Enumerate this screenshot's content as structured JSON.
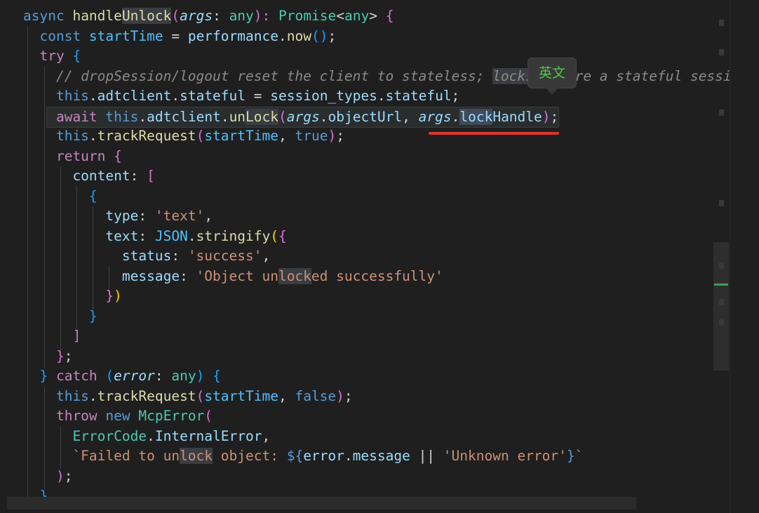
{
  "editor": {
    "lines": [
      [
        {
          "t": "async ",
          "c": "#569cd6"
        },
        {
          "t": "handle",
          "c": "#dcdcaa"
        },
        {
          "t": "Unlock",
          "c": "#dcdcaa",
          "h": 1
        },
        {
          "t": "(",
          "c": "#da70d6"
        },
        {
          "t": "args",
          "c": "#9cdcfe",
          "i": 1
        },
        {
          "t": ": ",
          "c": "#d4d4d4"
        },
        {
          "t": "any",
          "c": "#4ec9b0"
        },
        {
          "t": "): ",
          "c": "#da70d6"
        },
        {
          "t": "Promise",
          "c": "#4ec9b0"
        },
        {
          "t": "<",
          "c": "#d4d4d4"
        },
        {
          "t": "any",
          "c": "#4ec9b0"
        },
        {
          "t": "> ",
          "c": "#d4d4d4"
        },
        {
          "t": "{",
          "c": "#da70d6"
        }
      ],
      [
        {
          "t": "  const ",
          "c": "#569cd6"
        },
        {
          "t": "startTime",
          "c": "#4fc1ff"
        },
        {
          "t": " = ",
          "c": "#d4d4d4"
        },
        {
          "t": "performance",
          "c": "#9cdcfe"
        },
        {
          "t": ".",
          "c": "#d4d4d4"
        },
        {
          "t": "now",
          "c": "#dcdcaa"
        },
        {
          "t": "()",
          "c": "#179fff"
        },
        {
          "t": ";",
          "c": "#d4d4d4"
        }
      ],
      [
        {
          "t": "  try ",
          "c": "#c586c0"
        },
        {
          "t": "{",
          "c": "#179fff"
        }
      ],
      [
        {
          "t": "    // dropSession/logout reset the client to stateless; ",
          "c": "#8a8a8a",
          "i": 1
        },
        {
          "t": "locks",
          "c": "#8a8a8a",
          "i": 1,
          "h": 1
        },
        {
          "t": "     re a stateful sessi",
          "c": "#8a8a8a",
          "i": 1
        }
      ],
      [
        {
          "t": "    this",
          "c": "#569cd6"
        },
        {
          "t": ".",
          "c": "#d4d4d4"
        },
        {
          "t": "adtclient",
          "c": "#9cdcfe"
        },
        {
          "t": ".",
          "c": "#d4d4d4"
        },
        {
          "t": "stateful",
          "c": "#9cdcfe"
        },
        {
          "t": " = ",
          "c": "#d4d4d4"
        },
        {
          "t": "session_types",
          "c": "#9cdcfe"
        },
        {
          "t": ".",
          "c": "#d4d4d4"
        },
        {
          "t": "stateful",
          "c": "#9cdcfe"
        },
        {
          "t": ";",
          "c": "#d4d4d4"
        }
      ],
      [
        {
          "t": "    ",
          "c": "#d4d4d4"
        },
        {
          "t": "await ",
          "c": "#c586c0",
          "L": 1
        },
        {
          "t": "this",
          "c": "#569cd6",
          "L": 1
        },
        {
          "t": ".",
          "c": "#d4d4d4",
          "L": 1
        },
        {
          "t": "adtclient",
          "c": "#9cdcfe",
          "L": 1
        },
        {
          "t": ".",
          "c": "#d4d4d4",
          "L": 1
        },
        {
          "t": "un",
          "c": "#dcdcaa",
          "L": 1
        },
        {
          "t": "Lock",
          "c": "#dcdcaa",
          "h": 1
        },
        {
          "t": "(",
          "c": "#da70d6",
          "L": 1
        },
        {
          "t": "args",
          "c": "#9cdcfe",
          "i": 1,
          "L": 1
        },
        {
          "t": ".",
          "c": "#d4d4d4",
          "L": 1
        },
        {
          "t": "objectUrl",
          "c": "#9cdcfe",
          "L": 1
        },
        {
          "t": ", ",
          "c": "#d4d4d4",
          "L": 1
        },
        {
          "t": "args",
          "c": "#9cdcfe",
          "i": 1,
          "L": 1
        },
        {
          "t": ".",
          "c": "#d4d4d4",
          "L": 1
        },
        {
          "t": "lock",
          "c": "#9cdcfe",
          "h": 2
        },
        {
          "t": "Handle",
          "c": "#9cdcfe",
          "L": 1
        },
        {
          "t": ")",
          "c": "#da70d6",
          "L": 1
        },
        {
          "t": ";",
          "c": "#d4d4d4",
          "L": 1
        }
      ],
      [
        {
          "t": "    this",
          "c": "#569cd6"
        },
        {
          "t": ".",
          "c": "#d4d4d4"
        },
        {
          "t": "trackRequest",
          "c": "#dcdcaa"
        },
        {
          "t": "(",
          "c": "#da70d6"
        },
        {
          "t": "startTime",
          "c": "#4fc1ff"
        },
        {
          "t": ", ",
          "c": "#d4d4d4"
        },
        {
          "t": "true",
          "c": "#569cd6"
        },
        {
          "t": ")",
          "c": "#da70d6"
        },
        {
          "t": ";",
          "c": "#d4d4d4"
        }
      ],
      [
        {
          "t": "    return ",
          "c": "#c586c0"
        },
        {
          "t": "{",
          "c": "#da70d6"
        }
      ],
      [
        {
          "t": "      content",
          "c": "#9cdcfe"
        },
        {
          "t": ": ",
          "c": "#d4d4d4"
        },
        {
          "t": "[",
          "c": "#da70d6"
        }
      ],
      [
        {
          "t": "        {",
          "c": "#179fff"
        }
      ],
      [
        {
          "t": "          type",
          "c": "#9cdcfe"
        },
        {
          "t": ": ",
          "c": "#d4d4d4"
        },
        {
          "t": "'text'",
          "c": "#ce9178"
        },
        {
          "t": ",",
          "c": "#d4d4d4"
        }
      ],
      [
        {
          "t": "          text",
          "c": "#9cdcfe"
        },
        {
          "t": ": ",
          "c": "#d4d4d4"
        },
        {
          "t": "JSON",
          "c": "#4fc1ff"
        },
        {
          "t": ".",
          "c": "#d4d4d4"
        },
        {
          "t": "stringify",
          "c": "#dcdcaa"
        },
        {
          "t": "(",
          "c": "#ffd700"
        },
        {
          "t": "{",
          "c": "#da70d6"
        }
      ],
      [
        {
          "t": "            status",
          "c": "#9cdcfe"
        },
        {
          "t": ": ",
          "c": "#d4d4d4"
        },
        {
          "t": "'success'",
          "c": "#ce9178"
        },
        {
          "t": ",",
          "c": "#d4d4d4"
        }
      ],
      [
        {
          "t": "            message",
          "c": "#9cdcfe"
        },
        {
          "t": ": ",
          "c": "#d4d4d4"
        },
        {
          "t": "'Object un",
          "c": "#ce9178"
        },
        {
          "t": "lock",
          "c": "#ce9178",
          "h": 1
        },
        {
          "t": "ed successfully'",
          "c": "#ce9178"
        }
      ],
      [
        {
          "t": "          }",
          "c": "#da70d6"
        },
        {
          "t": ")",
          "c": "#ffd700"
        }
      ],
      [
        {
          "t": "        }",
          "c": "#179fff"
        }
      ],
      [
        {
          "t": "      ]",
          "c": "#da70d6"
        }
      ],
      [
        {
          "t": "    }",
          "c": "#da70d6"
        },
        {
          "t": ";",
          "c": "#d4d4d4"
        }
      ],
      [
        {
          "t": "  } ",
          "c": "#179fff"
        },
        {
          "t": "catch ",
          "c": "#c586c0"
        },
        {
          "t": "(",
          "c": "#179fff"
        },
        {
          "t": "error",
          "c": "#9cdcfe",
          "i": 1
        },
        {
          "t": ": ",
          "c": "#d4d4d4"
        },
        {
          "t": "any",
          "c": "#4ec9b0"
        },
        {
          "t": ") ",
          "c": "#179fff"
        },
        {
          "t": "{",
          "c": "#179fff"
        }
      ],
      [
        {
          "t": "    this",
          "c": "#569cd6"
        },
        {
          "t": ".",
          "c": "#d4d4d4"
        },
        {
          "t": "trackRequest",
          "c": "#dcdcaa"
        },
        {
          "t": "(",
          "c": "#da70d6"
        },
        {
          "t": "startTime",
          "c": "#4fc1ff"
        },
        {
          "t": ", ",
          "c": "#d4d4d4"
        },
        {
          "t": "false",
          "c": "#569cd6"
        },
        {
          "t": ")",
          "c": "#da70d6"
        },
        {
          "t": ";",
          "c": "#d4d4d4"
        }
      ],
      [
        {
          "t": "    throw ",
          "c": "#c586c0"
        },
        {
          "t": "new ",
          "c": "#569cd6"
        },
        {
          "t": "McpError",
          "c": "#4ec9b0"
        },
        {
          "t": "(",
          "c": "#da70d6"
        }
      ],
      [
        {
          "t": "      ErrorCode",
          "c": "#4ec9b0"
        },
        {
          "t": ".",
          "c": "#d4d4d4"
        },
        {
          "t": "InternalError",
          "c": "#9cdcfe"
        },
        {
          "t": ",",
          "c": "#d4d4d4"
        }
      ],
      [
        {
          "t": "      `Failed to un",
          "c": "#ce9178"
        },
        {
          "t": "lock",
          "c": "#ce9178",
          "h": 1
        },
        {
          "t": " object: ",
          "c": "#ce9178"
        },
        {
          "t": "${",
          "c": "#569cd6"
        },
        {
          "t": "error",
          "c": "#9cdcfe"
        },
        {
          "t": ".",
          "c": "#d4d4d4"
        },
        {
          "t": "message",
          "c": "#9cdcfe"
        },
        {
          "t": " || ",
          "c": "#d4d4d4"
        },
        {
          "t": "'Unknown error'",
          "c": "#ce9178"
        },
        {
          "t": "}",
          "c": "#569cd6"
        },
        {
          "t": "`",
          "c": "#ce9178"
        }
      ],
      [
        {
          "t": "    ",
          "c": "#d4d4d4"
        },
        {
          "t": ")",
          "c": "#da70d6"
        },
        {
          "t": ";",
          "c": "#d4d4d4"
        }
      ],
      [
        {
          "t": "  }",
          "c": "#179fff"
        }
      ]
    ]
  },
  "tooltip": {
    "text": "英文"
  },
  "colors": {
    "background": "#1f1f1f",
    "underline": "#e0342d",
    "tooltip_text": "#4ec94e"
  }
}
